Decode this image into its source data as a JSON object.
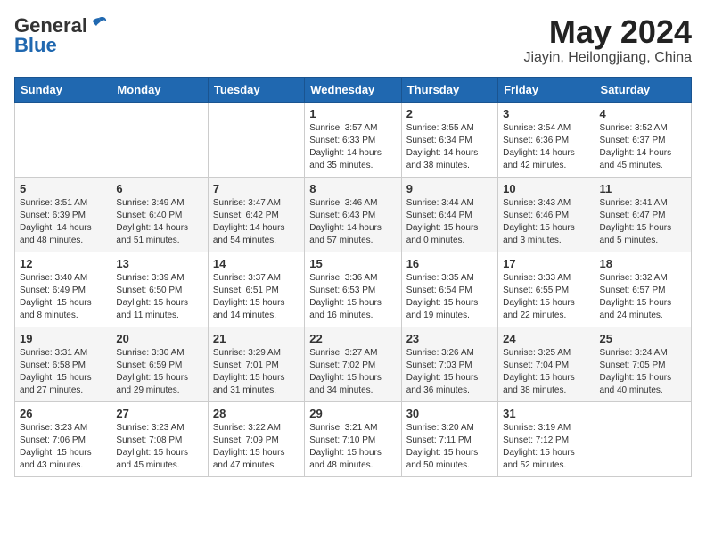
{
  "logo": {
    "general": "General",
    "blue": "Blue"
  },
  "title": "May 2024",
  "location": "Jiayin, Heilongjiang, China",
  "days_header": [
    "Sunday",
    "Monday",
    "Tuesday",
    "Wednesday",
    "Thursday",
    "Friday",
    "Saturday"
  ],
  "weeks": [
    [
      {
        "day": "",
        "content": ""
      },
      {
        "day": "",
        "content": ""
      },
      {
        "day": "",
        "content": ""
      },
      {
        "day": "1",
        "content": "Sunrise: 3:57 AM\nSunset: 6:33 PM\nDaylight: 14 hours\nand 35 minutes."
      },
      {
        "day": "2",
        "content": "Sunrise: 3:55 AM\nSunset: 6:34 PM\nDaylight: 14 hours\nand 38 minutes."
      },
      {
        "day": "3",
        "content": "Sunrise: 3:54 AM\nSunset: 6:36 PM\nDaylight: 14 hours\nand 42 minutes."
      },
      {
        "day": "4",
        "content": "Sunrise: 3:52 AM\nSunset: 6:37 PM\nDaylight: 14 hours\nand 45 minutes."
      }
    ],
    [
      {
        "day": "5",
        "content": "Sunrise: 3:51 AM\nSunset: 6:39 PM\nDaylight: 14 hours\nand 48 minutes."
      },
      {
        "day": "6",
        "content": "Sunrise: 3:49 AM\nSunset: 6:40 PM\nDaylight: 14 hours\nand 51 minutes."
      },
      {
        "day": "7",
        "content": "Sunrise: 3:47 AM\nSunset: 6:42 PM\nDaylight: 14 hours\nand 54 minutes."
      },
      {
        "day": "8",
        "content": "Sunrise: 3:46 AM\nSunset: 6:43 PM\nDaylight: 14 hours\nand 57 minutes."
      },
      {
        "day": "9",
        "content": "Sunrise: 3:44 AM\nSunset: 6:44 PM\nDaylight: 15 hours\nand 0 minutes."
      },
      {
        "day": "10",
        "content": "Sunrise: 3:43 AM\nSunset: 6:46 PM\nDaylight: 15 hours\nand 3 minutes."
      },
      {
        "day": "11",
        "content": "Sunrise: 3:41 AM\nSunset: 6:47 PM\nDaylight: 15 hours\nand 5 minutes."
      }
    ],
    [
      {
        "day": "12",
        "content": "Sunrise: 3:40 AM\nSunset: 6:49 PM\nDaylight: 15 hours\nand 8 minutes."
      },
      {
        "day": "13",
        "content": "Sunrise: 3:39 AM\nSunset: 6:50 PM\nDaylight: 15 hours\nand 11 minutes."
      },
      {
        "day": "14",
        "content": "Sunrise: 3:37 AM\nSunset: 6:51 PM\nDaylight: 15 hours\nand 14 minutes."
      },
      {
        "day": "15",
        "content": "Sunrise: 3:36 AM\nSunset: 6:53 PM\nDaylight: 15 hours\nand 16 minutes."
      },
      {
        "day": "16",
        "content": "Sunrise: 3:35 AM\nSunset: 6:54 PM\nDaylight: 15 hours\nand 19 minutes."
      },
      {
        "day": "17",
        "content": "Sunrise: 3:33 AM\nSunset: 6:55 PM\nDaylight: 15 hours\nand 22 minutes."
      },
      {
        "day": "18",
        "content": "Sunrise: 3:32 AM\nSunset: 6:57 PM\nDaylight: 15 hours\nand 24 minutes."
      }
    ],
    [
      {
        "day": "19",
        "content": "Sunrise: 3:31 AM\nSunset: 6:58 PM\nDaylight: 15 hours\nand 27 minutes."
      },
      {
        "day": "20",
        "content": "Sunrise: 3:30 AM\nSunset: 6:59 PM\nDaylight: 15 hours\nand 29 minutes."
      },
      {
        "day": "21",
        "content": "Sunrise: 3:29 AM\nSunset: 7:01 PM\nDaylight: 15 hours\nand 31 minutes."
      },
      {
        "day": "22",
        "content": "Sunrise: 3:27 AM\nSunset: 7:02 PM\nDaylight: 15 hours\nand 34 minutes."
      },
      {
        "day": "23",
        "content": "Sunrise: 3:26 AM\nSunset: 7:03 PM\nDaylight: 15 hours\nand 36 minutes."
      },
      {
        "day": "24",
        "content": "Sunrise: 3:25 AM\nSunset: 7:04 PM\nDaylight: 15 hours\nand 38 minutes."
      },
      {
        "day": "25",
        "content": "Sunrise: 3:24 AM\nSunset: 7:05 PM\nDaylight: 15 hours\nand 40 minutes."
      }
    ],
    [
      {
        "day": "26",
        "content": "Sunrise: 3:23 AM\nSunset: 7:06 PM\nDaylight: 15 hours\nand 43 minutes."
      },
      {
        "day": "27",
        "content": "Sunrise: 3:23 AM\nSunset: 7:08 PM\nDaylight: 15 hours\nand 45 minutes."
      },
      {
        "day": "28",
        "content": "Sunrise: 3:22 AM\nSunset: 7:09 PM\nDaylight: 15 hours\nand 47 minutes."
      },
      {
        "day": "29",
        "content": "Sunrise: 3:21 AM\nSunset: 7:10 PM\nDaylight: 15 hours\nand 48 minutes."
      },
      {
        "day": "30",
        "content": "Sunrise: 3:20 AM\nSunset: 7:11 PM\nDaylight: 15 hours\nand 50 minutes."
      },
      {
        "day": "31",
        "content": "Sunrise: 3:19 AM\nSunset: 7:12 PM\nDaylight: 15 hours\nand 52 minutes."
      },
      {
        "day": "",
        "content": ""
      }
    ]
  ]
}
